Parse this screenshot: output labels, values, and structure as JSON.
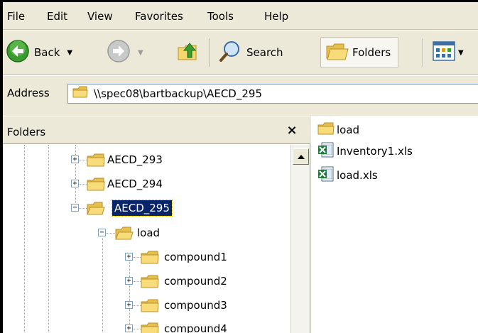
{
  "menu": {
    "items": [
      "File",
      "Edit",
      "View",
      "Favorites",
      "Tools",
      "Help"
    ]
  },
  "toolbar": {
    "back_label": "Back",
    "search_label": "Search",
    "folders_label": "Folders"
  },
  "address": {
    "label": "Address",
    "value": "\\\\spec08\\bartbackup\\AECD_295"
  },
  "folders_pane": {
    "title": "Folders",
    "close_label": "×",
    "tree": [
      {
        "label": "AECD_293",
        "expander": "+",
        "selected": false,
        "level": 1
      },
      {
        "label": "AECD_294",
        "expander": "+",
        "selected": false,
        "level": 1
      },
      {
        "label": "AECD_295",
        "expander": "−",
        "selected": true,
        "level": 1
      },
      {
        "label": "load",
        "expander": "−",
        "selected": false,
        "level": 2
      },
      {
        "label": "compound1",
        "expander": "+",
        "selected": false,
        "level": 3
      },
      {
        "label": "compound2",
        "expander": "+",
        "selected": false,
        "level": 3
      },
      {
        "label": "compound3",
        "expander": "+",
        "selected": false,
        "level": 3
      },
      {
        "label": "compound4",
        "expander": "+",
        "selected": false,
        "level": 3
      }
    ]
  },
  "files_pane": {
    "items": [
      {
        "label": "load",
        "type": "folder"
      },
      {
        "label": "Inventory1.xls",
        "type": "excel"
      },
      {
        "label": "load.xls",
        "type": "excel"
      }
    ]
  },
  "colors": {
    "selection_bg": "#0a246a",
    "back_arrow_green": "#3a9c2f",
    "folder_yellow": "#f5d76e"
  }
}
